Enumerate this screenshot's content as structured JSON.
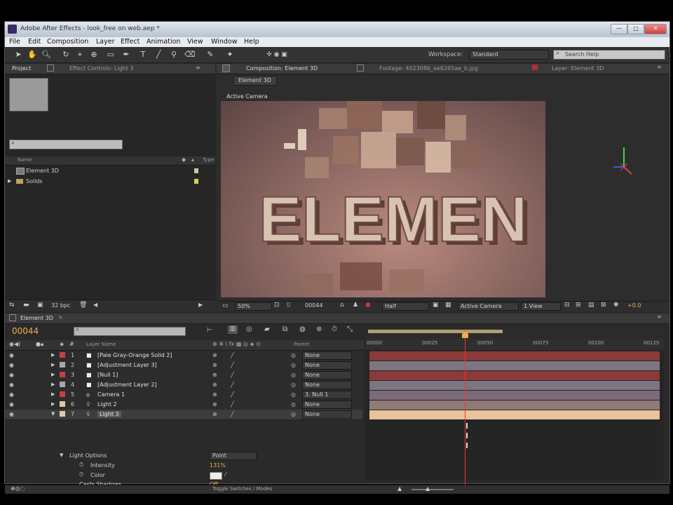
{
  "window": {
    "title": "Adobe After Effects - look_free on web.aep *",
    "min": "—",
    "max": "□",
    "close": "✕"
  },
  "menu": [
    "File",
    "Edit",
    "Composition",
    "Layer",
    "Effect",
    "Animation",
    "View",
    "Window",
    "Help"
  ],
  "toolbar": {
    "workspace_label": "Workspace:",
    "workspace_value": "Standard",
    "search_placeholder": "Search Help"
  },
  "project": {
    "tab_project": "Project",
    "tab_effect": "Effect Controls: Light 3",
    "col_name": "Name",
    "col_type": "Type",
    "items": [
      {
        "name": "Element 3D"
      },
      {
        "name": "Solids"
      }
    ],
    "bpc": "32 bpc"
  },
  "comp": {
    "tab": "Composition: Element 3D",
    "footage_tab": "Footage: 4023086_ae6265ae_b.jpg",
    "layer_tab": "Layer: Element 3D",
    "breadcrumb": "Element 3D",
    "camera_label": "Active Camera",
    "zoom": "50%",
    "timecode": "00044",
    "resolution": "Half",
    "view": "Active Camera",
    "views": "1 View",
    "exposure": "+0.0",
    "scene_text": "ELEMEN"
  },
  "timeline": {
    "tab": "Element 3D",
    "timecode": "00044",
    "col_layer_name": "Layer Name",
    "col_parent": "Parent",
    "ruler": [
      "00000",
      "00025",
      "00050",
      "00075",
      "00100",
      "00125"
    ],
    "layers": [
      {
        "num": "1",
        "name": "[Pale Gray-Orange Solid 2]",
        "color": "#c0443f",
        "parent": "None",
        "bar": "#8b3a3a"
      },
      {
        "num": "2",
        "name": "[Adjustment Layer 3]",
        "color": "#a7a7a7",
        "parent": "None",
        "bar": "#7d7680"
      },
      {
        "num": "3",
        "name": "[Null 1]",
        "color": "#c0443f",
        "parent": "None",
        "bar": "#8b3a3a"
      },
      {
        "num": "4",
        "name": "[Adjustment Layer 2]",
        "color": "#a7a7a7",
        "parent": "None",
        "bar": "#7d7680"
      },
      {
        "num": "5",
        "name": "Camera 1",
        "color": "#c0443f",
        "parent": "3. Null 1",
        "bar": "#7a6a7a"
      },
      {
        "num": "6",
        "name": "Light 2",
        "color": "#e0c8a8",
        "parent": "None",
        "bar": "#8e7b77"
      },
      {
        "num": "7",
        "name": "Light 3",
        "color": "#e0c8a8",
        "parent": "None",
        "bar": "#e9c39b"
      }
    ],
    "light_options": {
      "label": "Light Options",
      "type": "Point",
      "intensity_label": "Intensity",
      "intensity_value": "131%",
      "color_label": "Color",
      "shadow_label": "Casts Shadows",
      "shadow_value": "Off"
    },
    "footer": "Toggle Switches / Modes"
  },
  "colors": {
    "accent": "#e8b04a",
    "panel": "#262626"
  }
}
